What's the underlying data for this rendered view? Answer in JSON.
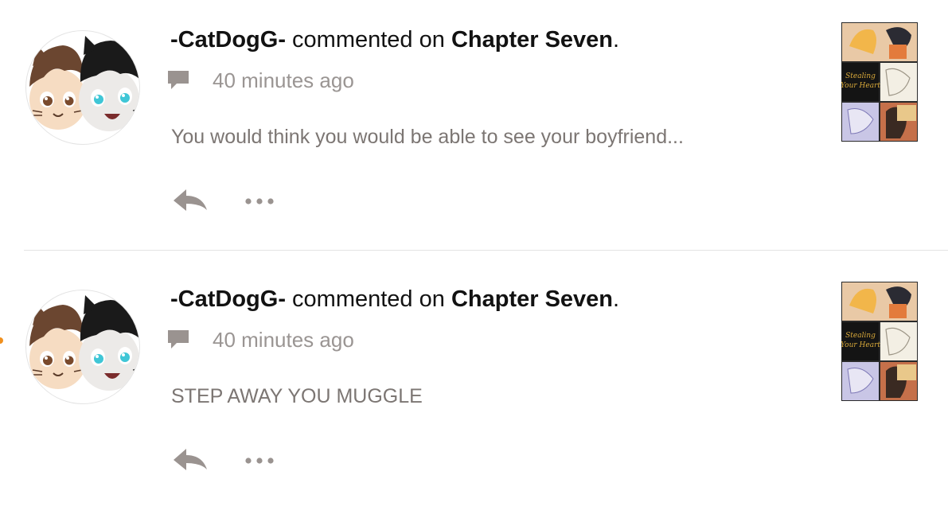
{
  "notifications": [
    {
      "avatar_icon": "cat-dog-avatar-icon",
      "user": "-CatDogG-",
      "action": " commented on ",
      "target": "Chapter Seven",
      "punct": ".",
      "type_icon": "comment-icon",
      "timestamp": "40 minutes ago",
      "body": "You would think you would be able to see your boyfriend...",
      "reply_icon": "reply-icon",
      "more_icon": "more-options-icon",
      "cover_icon": "story-cover-thumbnail"
    },
    {
      "avatar_icon": "cat-dog-avatar-icon",
      "user": "-CatDogG-",
      "action": " commented on ",
      "target": "Chapter Seven",
      "punct": ".",
      "type_icon": "comment-icon",
      "timestamp": "40 minutes ago",
      "body": "STEP AWAY YOU MUGGLE",
      "reply_icon": "reply-icon",
      "more_icon": "more-options-icon",
      "cover_icon": "story-cover-thumbnail"
    }
  ],
  "cover_title_art": "Stealing Your Heart",
  "colors": {
    "username": "#121212",
    "timestamp": "#9a9593",
    "body": "#7c7673",
    "icon": "#9a9390",
    "divider": "#e3e3e3",
    "unread_dot": "#f0901e"
  }
}
